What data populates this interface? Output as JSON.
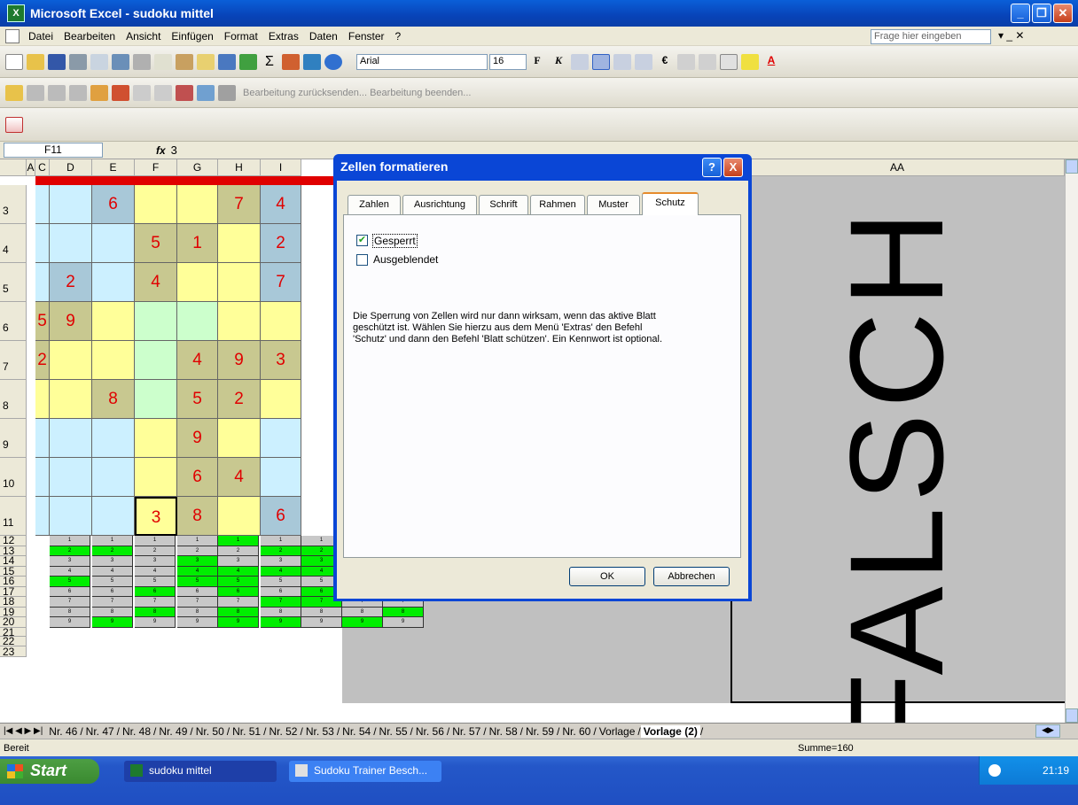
{
  "window": {
    "title": "Microsoft Excel - sudoku mittel",
    "menu": [
      "Datei",
      "Bearbeiten",
      "Ansicht",
      "Einfügen",
      "Format",
      "Extras",
      "Daten",
      "Fenster",
      "?"
    ],
    "help_placeholder": "Frage hier eingeben"
  },
  "toolbar": {
    "font_name": "Arial",
    "font_size": "16",
    "bold_label": "F",
    "italic_label": "K",
    "review_text": "Bearbeitung zurücksenden...   Bearbeitung beenden..."
  },
  "formula": {
    "cell_ref": "F11",
    "fx": "fx",
    "value": "3"
  },
  "sheet": {
    "columns": [
      "A",
      "C",
      "D",
      "E",
      "F",
      "G",
      "H",
      "I"
    ],
    "right_column": "AA",
    "rows": [
      "3",
      "4",
      "5",
      "6",
      "7",
      "8",
      "9",
      "10",
      "11",
      "12",
      "13",
      "14",
      "15",
      "16",
      "17",
      "18",
      "19",
      "20",
      "21",
      "22",
      "23"
    ],
    "big_text": "FALSCH",
    "grid": [
      [
        "",
        "",
        "6",
        "",
        "",
        "7",
        "4"
      ],
      [
        "",
        "",
        "",
        "5",
        "1",
        "",
        "2"
      ],
      [
        "",
        "2",
        "",
        "4",
        "",
        "",
        "7"
      ],
      [
        "5",
        "9",
        "",
        "",
        "",
        "",
        ""
      ],
      [
        "2",
        "",
        "",
        "",
        "4",
        "9",
        "3"
      ],
      [
        "",
        "",
        "8",
        "",
        "5",
        "2",
        ""
      ],
      [
        "",
        "",
        "",
        "",
        "9",
        "",
        ""
      ],
      [
        "",
        "",
        "",
        "",
        "6",
        "4",
        ""
      ],
      [
        "",
        "",
        "",
        "3",
        "8",
        "",
        "6"
      ]
    ]
  },
  "dialog": {
    "title": "Zellen formatieren",
    "tabs": [
      "Zahlen",
      "Ausrichtung",
      "Schrift",
      "Rahmen",
      "Muster",
      "Schutz"
    ],
    "checkbox_locked": "Gesperrt",
    "checkbox_hidden": "Ausgeblendet",
    "description": "Die Sperrung von Zellen wird nur dann wirksam, wenn das aktive Blatt geschützt ist. Wählen Sie hierzu aus dem Menü 'Extras' den Befehl 'Schutz' und dann den Befehl 'Blatt schützen'. Ein Kennwort ist optional.",
    "ok": "OK",
    "cancel": "Abbrechen",
    "help_btn": "?",
    "close_btn": "X"
  },
  "sheet_tabs": [
    "Nr. 46",
    "Nr. 47",
    "Nr. 48",
    "Nr. 49",
    "Nr. 50",
    "Nr. 51",
    "Nr. 52",
    "Nr. 53",
    "Nr. 54",
    "Nr. 55",
    "Nr. 56",
    "Nr. 57",
    "Nr. 58",
    "Nr. 59",
    "Nr. 60",
    "Vorlage",
    "Vorlage (2)"
  ],
  "status": {
    "ready": "Bereit",
    "sum": "Summe=160"
  },
  "taskbar": {
    "start": "Start",
    "tasks": [
      "sudoku mittel",
      "Sudoku Trainer Besch..."
    ],
    "clock": "21:19"
  }
}
